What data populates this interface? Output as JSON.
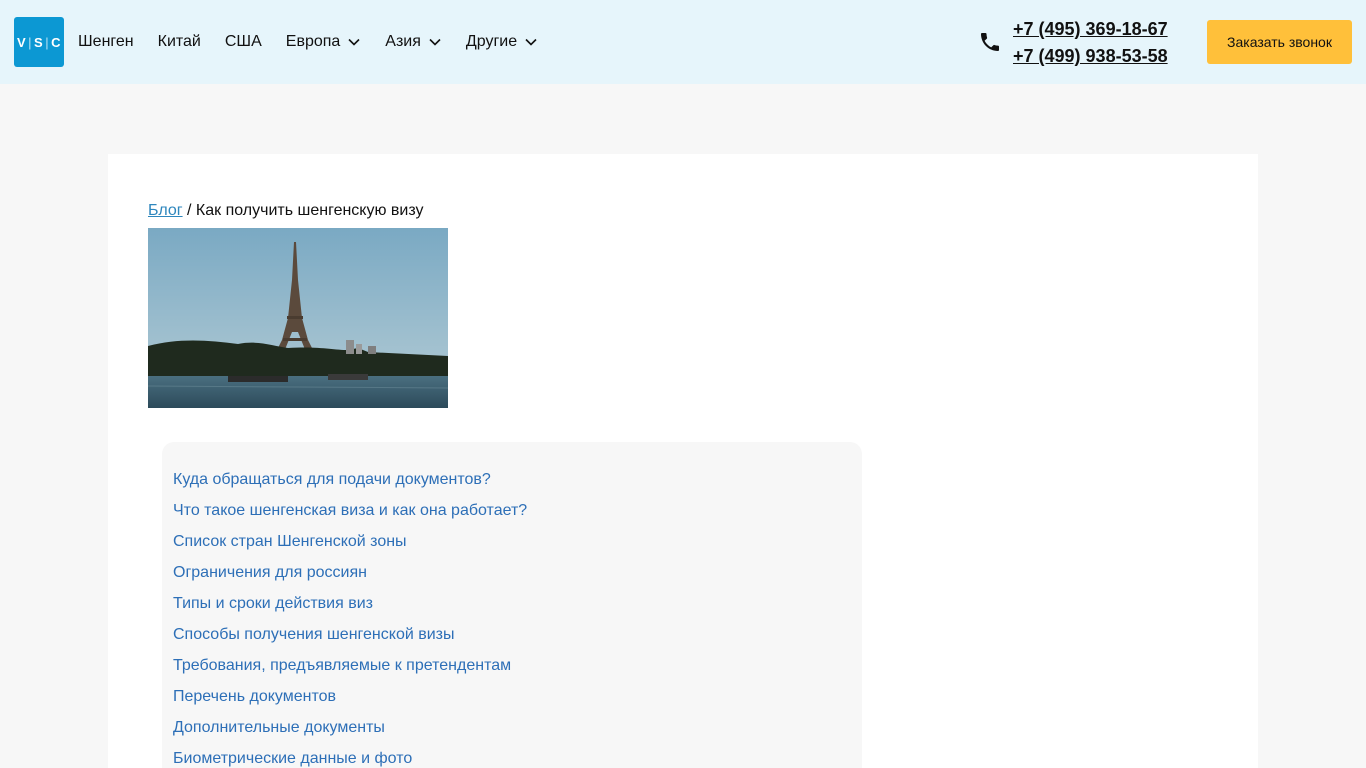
{
  "header": {
    "logo": {
      "left": "V",
      "middle": "S",
      "right": "C"
    },
    "nav": [
      {
        "label": "Шенген",
        "dropdown": false
      },
      {
        "label": "Китай",
        "dropdown": false
      },
      {
        "label": "США",
        "dropdown": false
      },
      {
        "label": "Европа",
        "dropdown": true
      },
      {
        "label": "Азия",
        "dropdown": true
      },
      {
        "label": "Другие",
        "dropdown": true
      }
    ],
    "phones": [
      "+7 (495) 369-18-67",
      "+7 (499) 938-53-58"
    ],
    "callback_label": "Заказать звонок"
  },
  "breadcrumb": {
    "link": "Блог",
    "separator": " / ",
    "current": "Как получить шенгенскую визу"
  },
  "toc": [
    "Куда обращаться для подачи документов?",
    "Что такое шенгенская виза и как она работает?",
    "Список стран Шенгенской зоны",
    "Ограничения для россиян",
    "Типы и сроки действия виз",
    "Способы получения шенгенской визы",
    "Требования, предъявляемые к претендентам",
    "Перечень документов",
    "Дополнительные документы",
    "Биометрические данные и фото"
  ],
  "colors": {
    "header_bg": "#e6f5fb",
    "logo_bg": "#0c98d3",
    "accent_button": "#ffc03a",
    "link": "#2d6fb7"
  },
  "icons": {
    "phone": "phone-icon",
    "dropdown": "chevron-down-icon"
  }
}
